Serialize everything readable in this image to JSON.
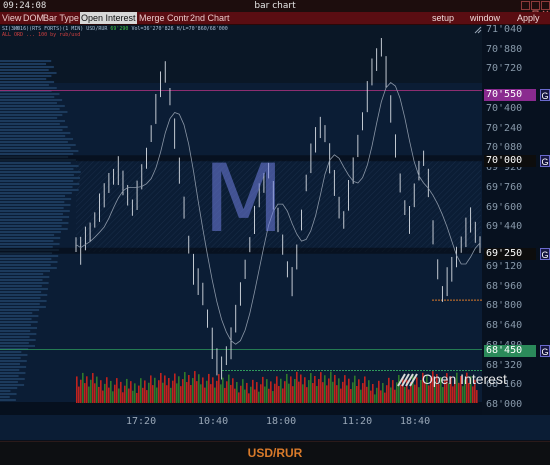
{
  "window": {
    "clock": "09:24:08",
    "title": "bar chart"
  },
  "menu": {
    "left": [
      "View",
      "DOM",
      "Bar Type",
      "Open Interest",
      "Merge Contr",
      "2nd Chart"
    ],
    "selected": "Open Interest",
    "right": [
      "setup",
      "window",
      "Apply"
    ]
  },
  "info": {
    "line1": "SI(3ИЮ16)(RTS FORTS)(1 MIN) USD/RUR",
    "line1_tail": "Vol=36'270'826 H/L=70'860/68'000",
    "line1_flag": "69'290",
    "line2": "ALL ORD ... 100 by rub/usd"
  },
  "price_labels": [
    {
      "text": "70'550",
      "bg": "#8a2a8f",
      "fg": "#ffffff",
      "price": 70550
    },
    {
      "text": "70'000",
      "bg": "#0d0d0d",
      "fg": "#ffffff",
      "price": 70000
    },
    {
      "text": "69'250",
      "bg": "#0d0d0d",
      "fg": "#ffffff",
      "price": 69250
    },
    {
      "text": "68'450",
      "bg": "#2b8a5a",
      "fg": "#ffffff",
      "price": 68450
    }
  ],
  "g_label": "G",
  "axis_prices": [
    "71'040",
    "70'880",
    "70'720",
    "70'400",
    "70'240",
    "70'080",
    "69'920",
    "69'760",
    "69'600",
    "69'440",
    "69'120",
    "68'960",
    "68'800",
    "68'640",
    "68'480",
    "68'320",
    "68'160",
    "68'000"
  ],
  "time_labels": [
    "17:20",
    "10:40",
    "18:00",
    "11:20",
    "18:40"
  ],
  "watermark": "M",
  "indicator_label": "Open Interest",
  "symbol": "USD/RUR",
  "colors": {
    "menu_bg": "#5a0d12",
    "chart_bg": "#0b1d35",
    "upper_band": "#0a1726",
    "accent_orange": "#d97a2a",
    "volume_green": "#2f7a2a",
    "volume_red": "#c0231e"
  },
  "chart_data": {
    "type": "bar",
    "price_range": [
      68000,
      71040
    ],
    "levels": [
      {
        "price": 70550,
        "style": "line",
        "color": "magenta"
      },
      {
        "price": 70000,
        "style": "band",
        "color": "dark"
      },
      {
        "price": 69250,
        "style": "band",
        "color": "dark"
      },
      {
        "price": 68850,
        "style": "dotted",
        "color": "orange"
      },
      {
        "price": 68450,
        "style": "line",
        "color": "green"
      },
      {
        "price": 68280,
        "style": "dotted",
        "color": "green"
      }
    ],
    "series": [
      {
        "values": [
          69300,
          69250,
          69350,
          69400,
          69500,
          69600,
          69700,
          69800,
          69850,
          69900,
          69800,
          69700,
          69600,
          69700,
          69850,
          70000,
          70200,
          70400,
          70600,
          70700,
          70500,
          70200,
          69900,
          69600,
          69300,
          69100,
          69000,
          68900,
          68700,
          68500,
          68350,
          68300,
          68400,
          68500,
          68700,
          68900,
          69100,
          69300,
          69500,
          69700,
          69800,
          69900,
          69700,
          69500,
          69300,
          69100,
          69000,
          69200,
          69500,
          69800,
          70000,
          70150,
          70250,
          70200,
          70000,
          69800,
          69600,
          69500,
          69700,
          69900,
          70100,
          70300,
          70500,
          70700,
          70800,
          70900,
          70700,
          70400,
          70100,
          69800,
          69600,
          69500,
          69700,
          69900,
          70000,
          69800,
          69400,
          69100,
          68900,
          69000,
          69100,
          69200,
          69300,
          69400,
          69500,
          69400,
          69300
        ]
      }
    ]
  }
}
